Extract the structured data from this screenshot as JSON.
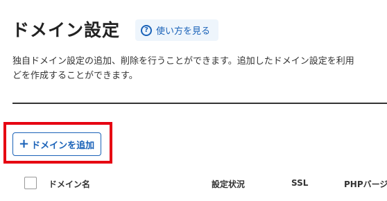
{
  "page": {
    "title": "ドメイン設定",
    "help_label": "使い方を見る",
    "help_icon": "question-circle-icon",
    "description_line1": "独自ドメイン設定の追加、削除を行うことができます。追加したドメイン設定を利用",
    "description_line2": "どを作成することができます。"
  },
  "actions": {
    "add_label": "ドメインを追加",
    "add_icon": "plus-icon",
    "plus_glyph": "+"
  },
  "table": {
    "columns": [
      "ドメイン名",
      "設定状況",
      "SSL",
      "PHPバージョ"
    ]
  },
  "colors": {
    "accent": "#1a62b8",
    "highlight": "#e60012"
  }
}
